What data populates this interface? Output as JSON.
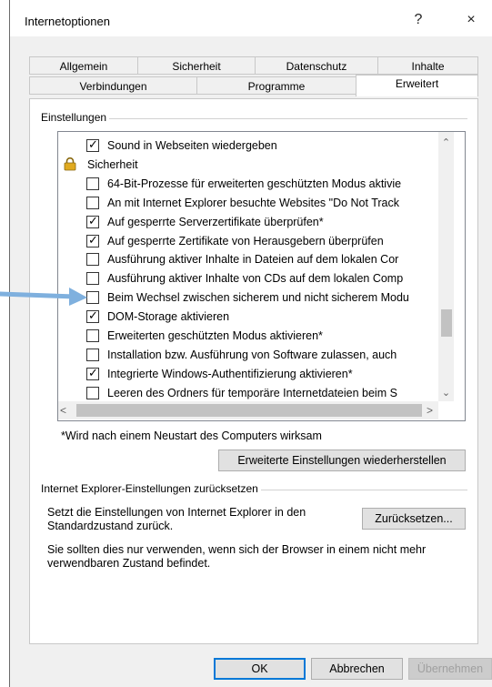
{
  "window": {
    "title": "Internetoptionen",
    "help": "?",
    "close": "×"
  },
  "tabs_row1": [
    "Allgemein",
    "Sicherheit",
    "Datenschutz",
    "Inhalte"
  ],
  "tabs_row2": [
    "Verbindungen",
    "Programme",
    "Erweitert"
  ],
  "settings": {
    "group_label": "Einstellungen",
    "items": [
      {
        "label": "Sound in Webseiten wiedergeben",
        "checked": true
      },
      {
        "label": "Sicherheit",
        "category": true
      },
      {
        "label": "64-Bit-Prozesse für erweiterten geschützten Modus aktivie",
        "checked": false
      },
      {
        "label": "An mit Internet Explorer besuchte Websites \"Do Not Track",
        "checked": false
      },
      {
        "label": "Auf gesperrte Serverzertifikate überprüfen*",
        "checked": true
      },
      {
        "label": "Auf gesperrte Zertifikate von Herausgebern überprüfen",
        "checked": true
      },
      {
        "label": "Ausführung aktiver Inhalte in Dateien auf dem lokalen Cor",
        "checked": false
      },
      {
        "label": "Ausführung aktiver Inhalte von CDs auf dem lokalen Comp",
        "checked": false
      },
      {
        "label": "Beim Wechsel zwischen sicherem und nicht sicherem Modu",
        "checked": false
      },
      {
        "label": "DOM-Storage aktivieren",
        "checked": true
      },
      {
        "label": "Erweiterten geschützten Modus aktivieren*",
        "checked": false
      },
      {
        "label": "Installation bzw. Ausführung von Software zulassen, auch",
        "checked": false
      },
      {
        "label": "Integrierte Windows-Authentifizierung aktivieren*",
        "checked": true
      },
      {
        "label": "Leeren des Ordners für temporäre Internetdateien beim S",
        "checked": false
      }
    ],
    "restart_note": "*Wird nach einem Neustart des Computers wirksam",
    "restore_button": "Erweiterte Einstellungen wiederherstellen"
  },
  "reset": {
    "group_label": "Internet Explorer-Einstellungen zurücksetzen",
    "description": "Setzt die Einstellungen von Internet Explorer in den Standardzustand zurück.",
    "button": "Zurücksetzen...",
    "warning": "Sie sollten dies nur verwenden, wenn sich der Browser in einem nicht mehr verwendbaren Zustand befindet."
  },
  "footer": {
    "ok": "OK",
    "cancel": "Abbrechen",
    "apply": "Übernehmen"
  },
  "colors": {
    "arrow": "#7fb0de",
    "accent": "#0078d7",
    "lock": "#d8a020"
  }
}
